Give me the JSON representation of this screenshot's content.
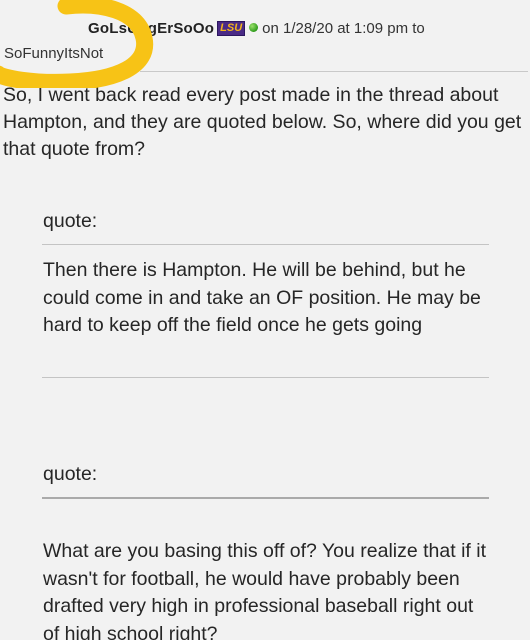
{
  "post": {
    "username": "GoLsUtIgErSoOo",
    "team_badge": "LSU",
    "meta": "on 1/28/20 at 1:09 pm to",
    "reply_to": "SoFunnyItsNot",
    "body": "So, I went back read every post made in the thread about Hampton, and they are quoted below. So, where did you get that quote from?"
  },
  "quotes": [
    {
      "label": "quote:",
      "text": "Then there is Hampton. He will be behind, but he could come in and take an OF position. He may be hard to keep off the field once he gets going"
    },
    {
      "label": "quote:",
      "text": "What are you basing this off of? You realize that if it wasn't for football, he would have probably been drafted very high in professional baseball right out of high school right?"
    }
  ],
  "colors": {
    "background": "#f2f2f2",
    "highlight": "#f7c316",
    "online_status": "#2f9c1c",
    "badge_purple": "#4a2a86",
    "badge_gold": "#f3b41b"
  },
  "icons": {
    "badge": "lsu-team-badge-icon",
    "status": "online-status-icon"
  }
}
